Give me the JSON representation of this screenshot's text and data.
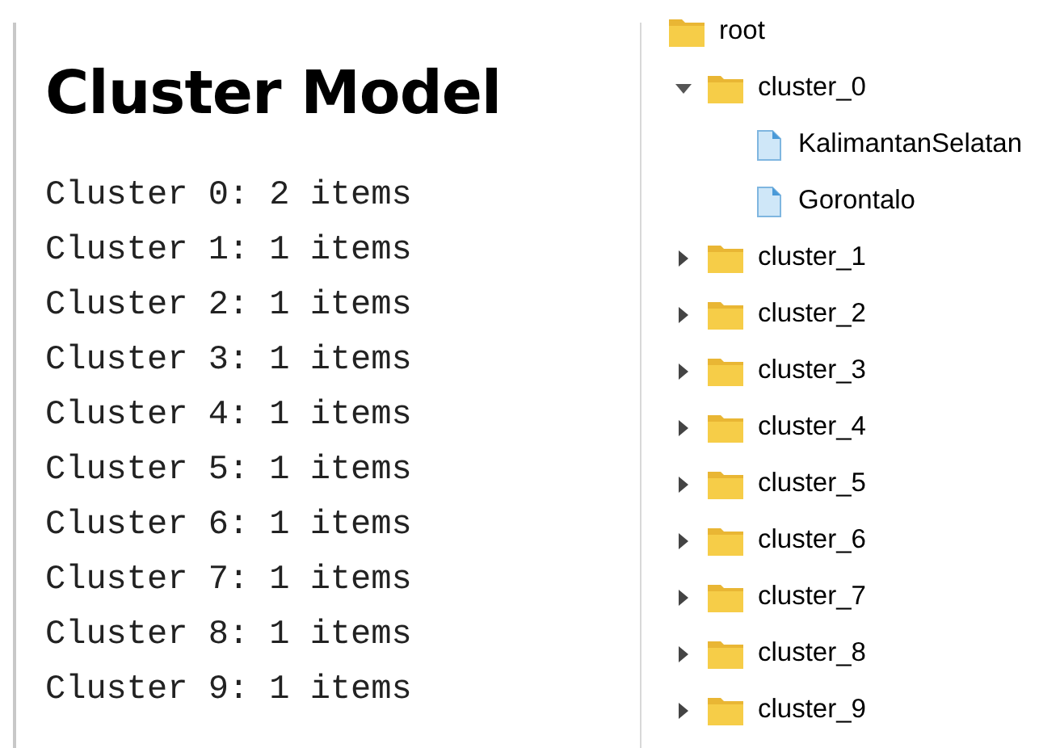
{
  "title": "Cluster Model",
  "summary": [
    "Cluster 0: 2 items",
    "Cluster 1: 1 items",
    "Cluster 2: 1 items",
    "Cluster 3: 1 items",
    "Cluster 4: 1 items",
    "Cluster 5: 1 items",
    "Cluster 6: 1 items",
    "Cluster 7: 1 items",
    "Cluster 8: 1 items",
    "Cluster 9: 1 items"
  ],
  "tree": {
    "label": "root",
    "kind": "folder",
    "children": [
      {
        "label": "cluster_0",
        "kind": "folder",
        "expanded": true,
        "children": [
          {
            "label": "KalimantanSelatan",
            "kind": "file"
          },
          {
            "label": "Gorontalo",
            "kind": "file"
          }
        ]
      },
      {
        "label": "cluster_1",
        "kind": "folder",
        "expanded": false
      },
      {
        "label": "cluster_2",
        "kind": "folder",
        "expanded": false
      },
      {
        "label": "cluster_3",
        "kind": "folder",
        "expanded": false
      },
      {
        "label": "cluster_4",
        "kind": "folder",
        "expanded": false
      },
      {
        "label": "cluster_5",
        "kind": "folder",
        "expanded": false
      },
      {
        "label": "cluster_6",
        "kind": "folder",
        "expanded": false
      },
      {
        "label": "cluster_7",
        "kind": "folder",
        "expanded": false
      },
      {
        "label": "cluster_8",
        "kind": "folder",
        "expanded": false
      },
      {
        "label": "cluster_9",
        "kind": "folder",
        "expanded": false
      }
    ]
  }
}
